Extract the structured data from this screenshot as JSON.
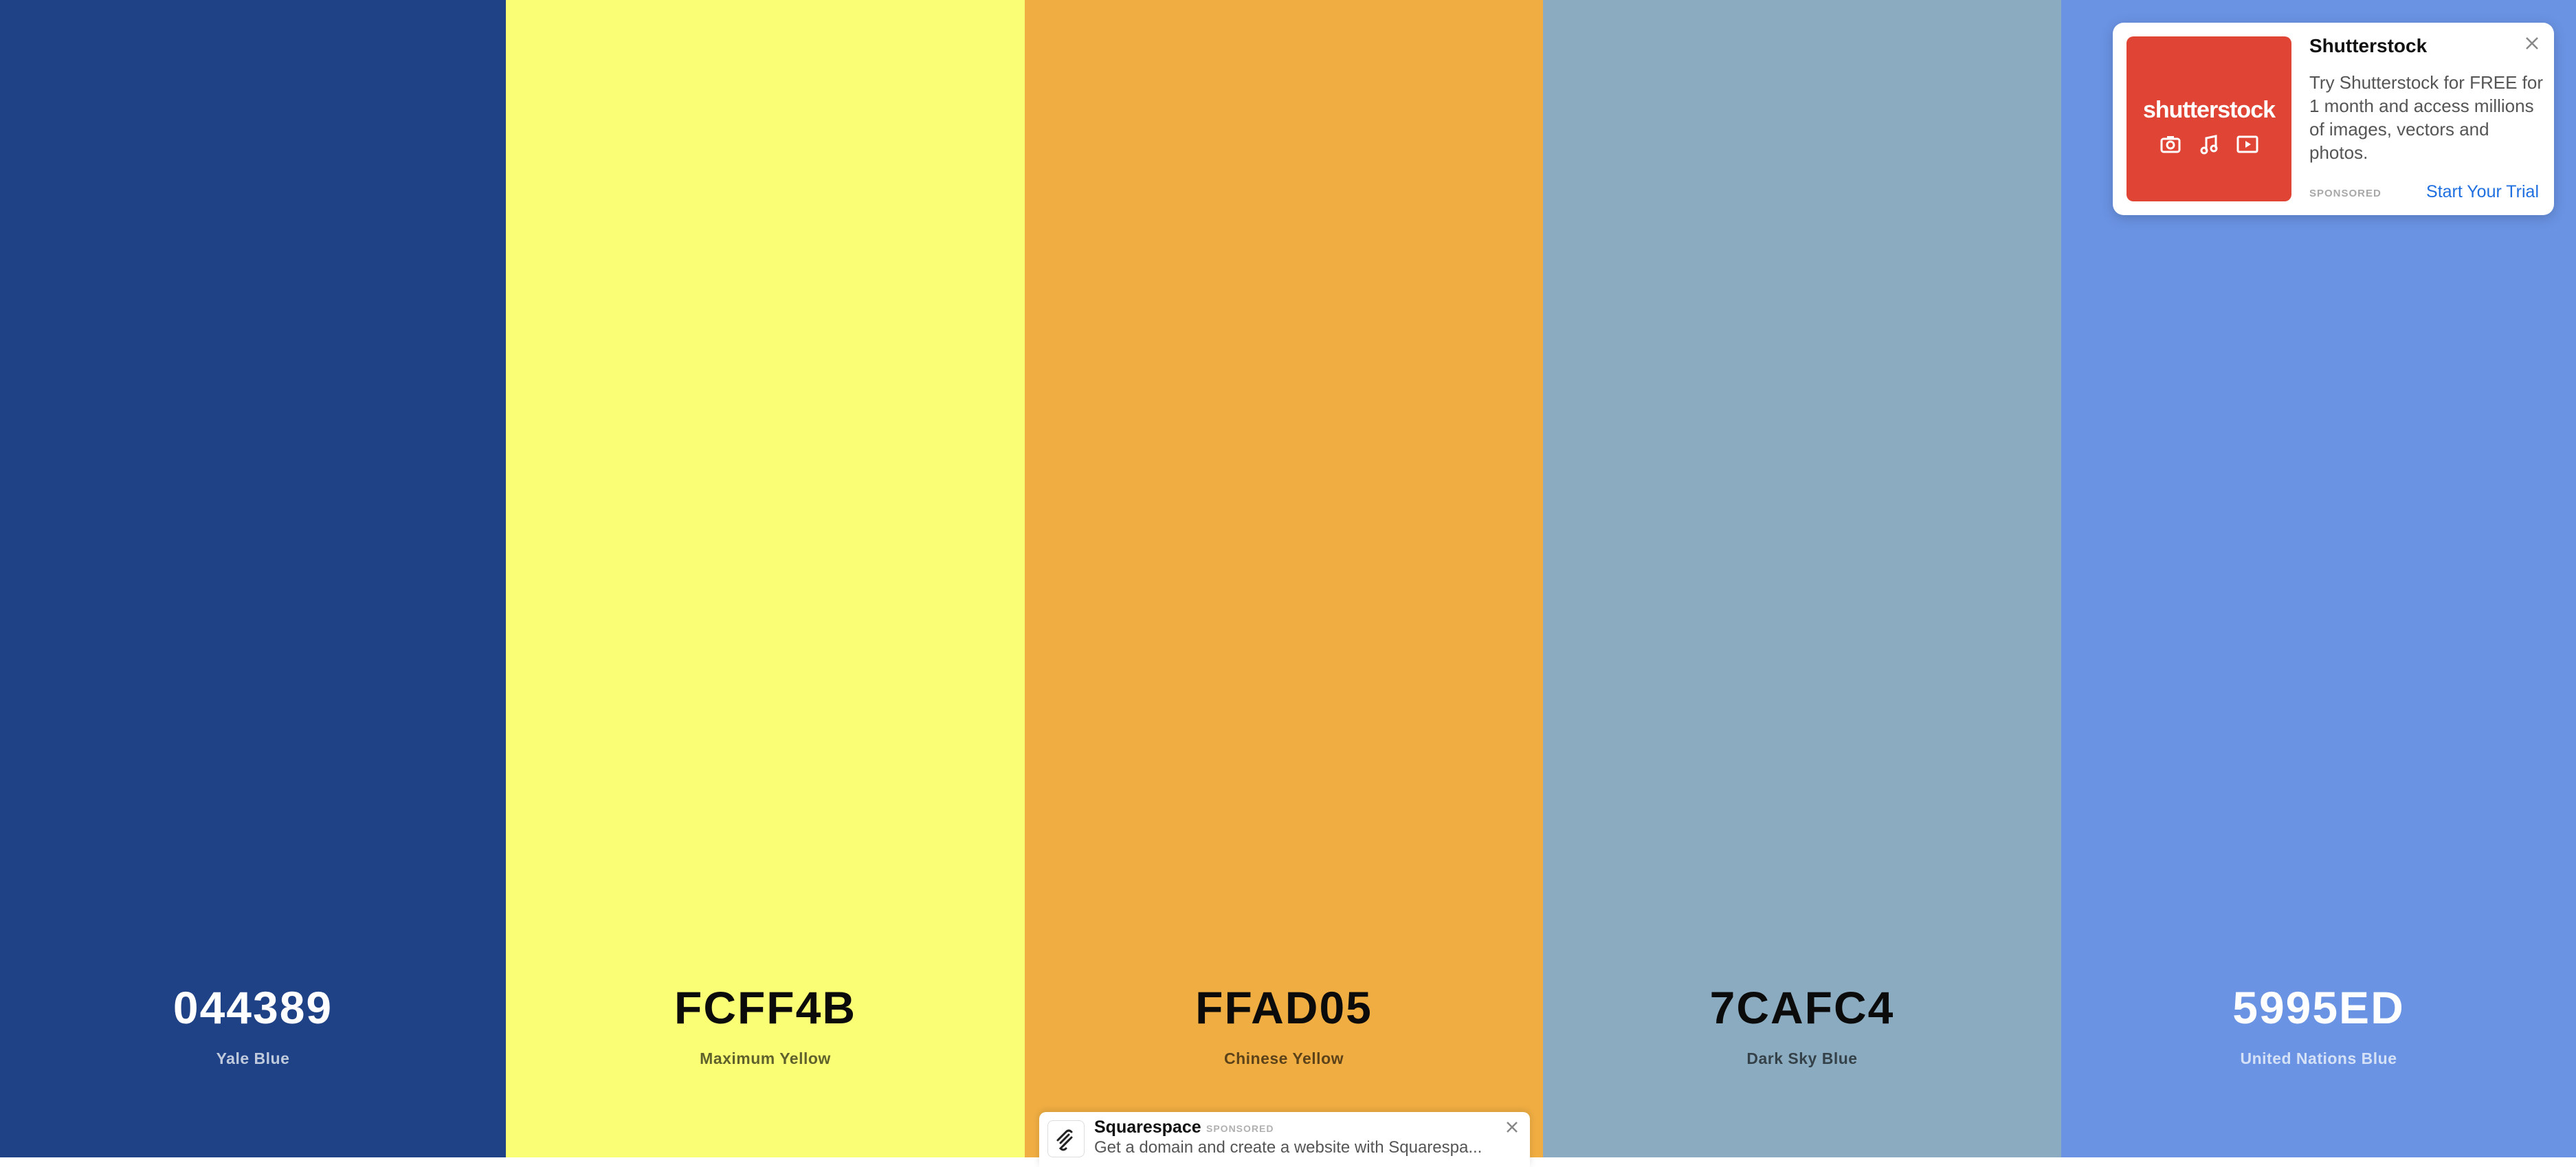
{
  "palette": [
    {
      "hex": "044389",
      "name": "Yale Blue",
      "color": "#1f4286",
      "tone": "dark"
    },
    {
      "hex": "FCFF4B",
      "name": "Maximum Yellow",
      "color": "#f9fe74",
      "tone": "light"
    },
    {
      "hex": "FFAD05",
      "name": "Chinese Yellow",
      "color": "#efad42",
      "tone": "light"
    },
    {
      "hex": "7CAFC4",
      "name": "Dark Sky Blue",
      "color": "#8bacc0",
      "tone": "light"
    },
    {
      "hex": "5995ED",
      "name": "United Nations Blue",
      "color": "#6a93e3",
      "tone": "dark"
    }
  ],
  "shutterstock_ad": {
    "title": "Shutterstock",
    "logo_text": "shutterstock",
    "body": "Try Shutterstock for FREE for 1 month and access millions of images, vectors and photos.",
    "sponsored": "SPONSORED",
    "cta": "Start Your Trial",
    "brand_color": "#e04434",
    "cta_color": "#1f6fe0"
  },
  "squarespace_ad": {
    "title": "Squarespace",
    "sponsored": "SPONSORED",
    "body": "Get a domain and create a website with Squarespa..."
  }
}
